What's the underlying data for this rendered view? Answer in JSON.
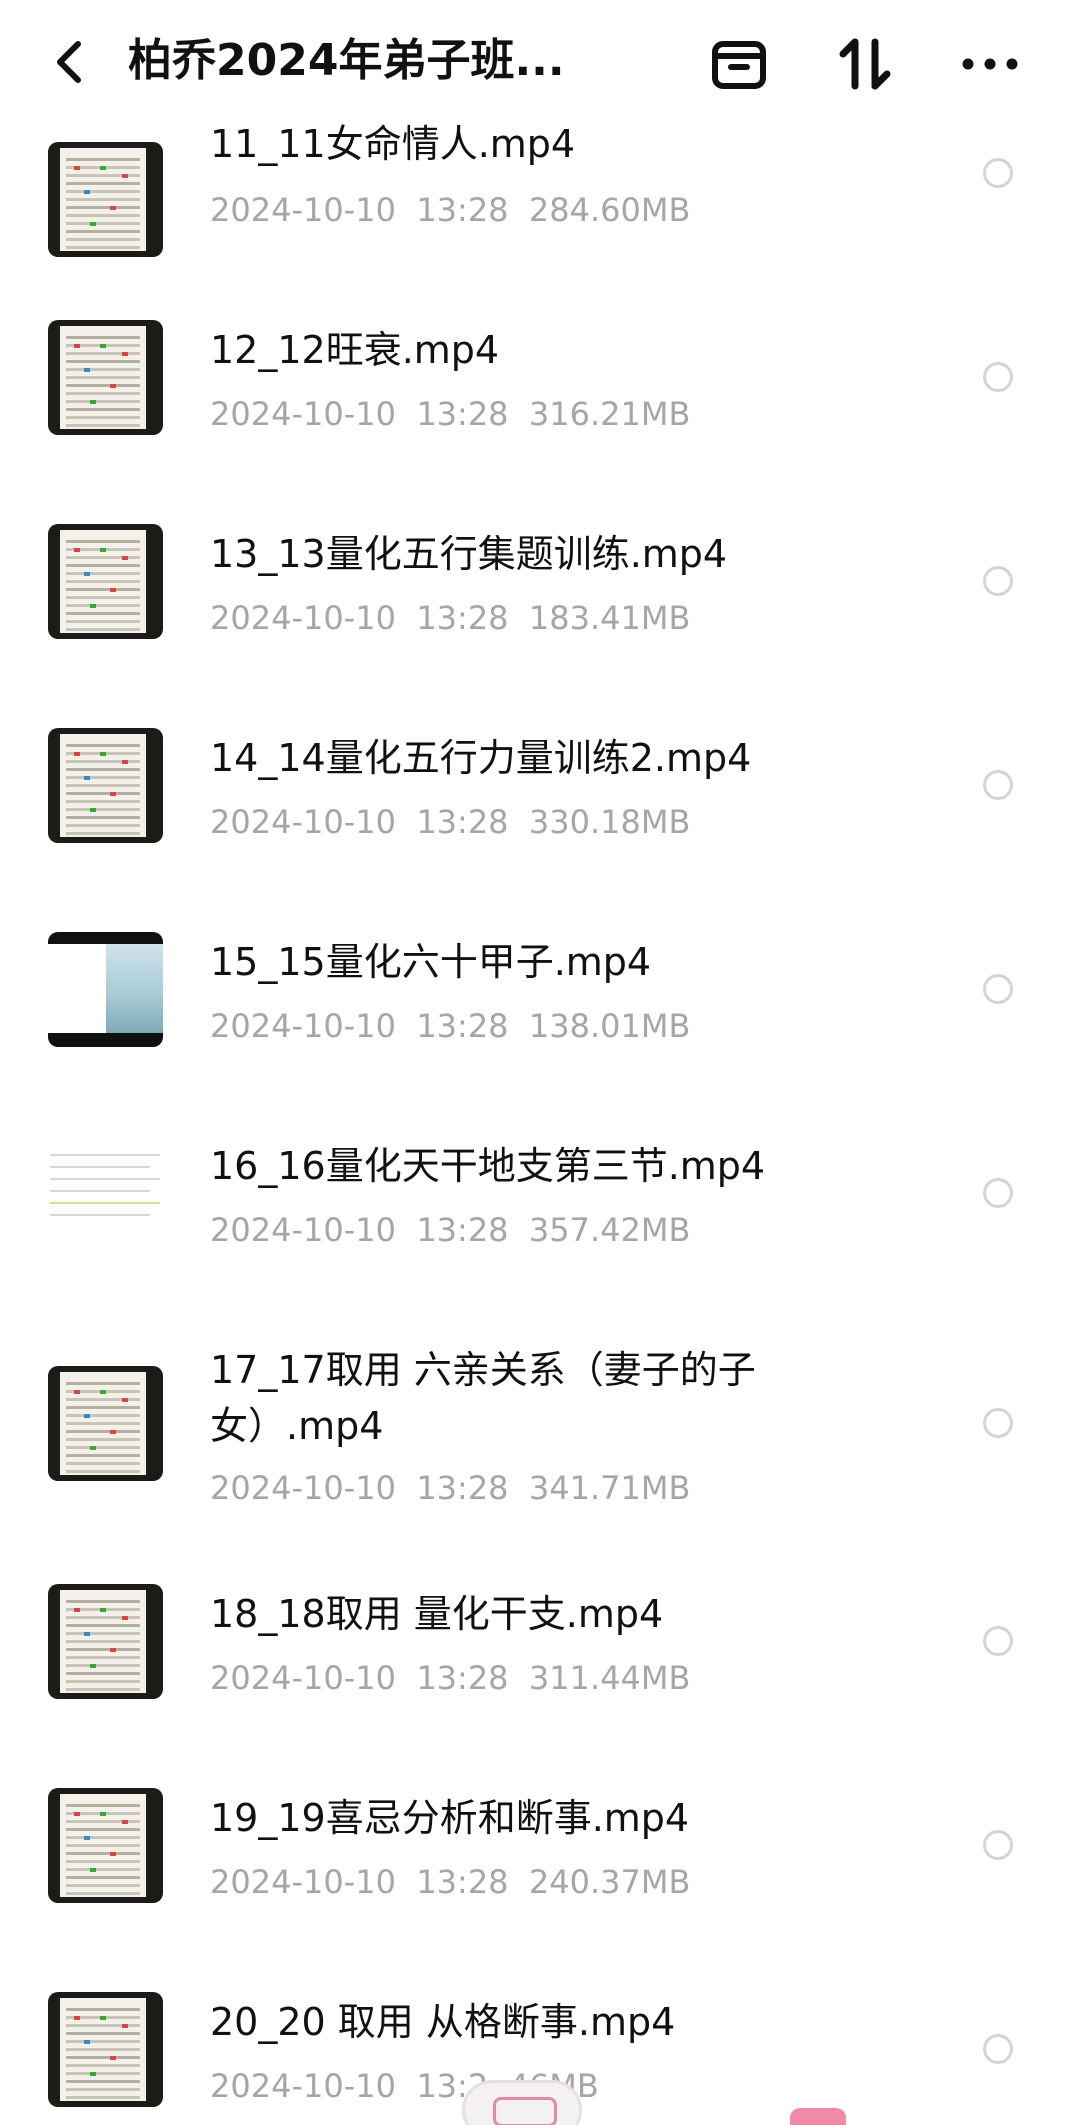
{
  "header": {
    "title": "柏乔2024年弟子班...",
    "icons": [
      "back-arrow-icon",
      "archive-icon",
      "sort-icon",
      "more-icon"
    ]
  },
  "files": [
    {
      "name": "11_11女命情人.mp4",
      "date": "2024-10-10",
      "time": "13:28",
      "size": "284.60MB",
      "thumb": "chart"
    },
    {
      "name": "12_12旺衰.mp4",
      "date": "2024-10-10",
      "time": "13:28",
      "size": "316.21MB",
      "thumb": "chart"
    },
    {
      "name": "13_13量化五行集题训练.mp4",
      "date": "2024-10-10",
      "time": "13:28",
      "size": "183.41MB",
      "thumb": "chart"
    },
    {
      "name": "14_14量化五行力量训练2.mp4",
      "date": "2024-10-10",
      "time": "13:28",
      "size": "330.18MB",
      "thumb": "chart"
    },
    {
      "name": "15_15量化六十甲子.mp4",
      "date": "2024-10-10",
      "time": "13:28",
      "size": "138.01MB",
      "thumb": "sea"
    },
    {
      "name": "16_16量化天干地支第三节.mp4",
      "date": "2024-10-10",
      "time": "13:28",
      "size": "357.42MB",
      "thumb": "doc"
    },
    {
      "name": "17_17取用 六亲关系（妻子的子女）.mp4",
      "date": "2024-10-10",
      "time": "13:28",
      "size": "341.71MB",
      "thumb": "chart"
    },
    {
      "name": "18_18取用 量化干支.mp4",
      "date": "2024-10-10",
      "time": "13:28",
      "size": "311.44MB",
      "thumb": "chart"
    },
    {
      "name": "19_19喜忌分析和断事.mp4",
      "date": "2024-10-10",
      "time": "13:28",
      "size": "240.37MB",
      "thumb": "chart"
    },
    {
      "name": "20_20 取用 从格断事.mp4",
      "date": "2024-10-10",
      "time": "13:2",
      "size": "46MB",
      "thumb": "chart"
    }
  ],
  "colors": {
    "text": "#111111",
    "meta": "#a6a6a6",
    "radio": "#d4d4d4",
    "background": "#ffffff"
  }
}
